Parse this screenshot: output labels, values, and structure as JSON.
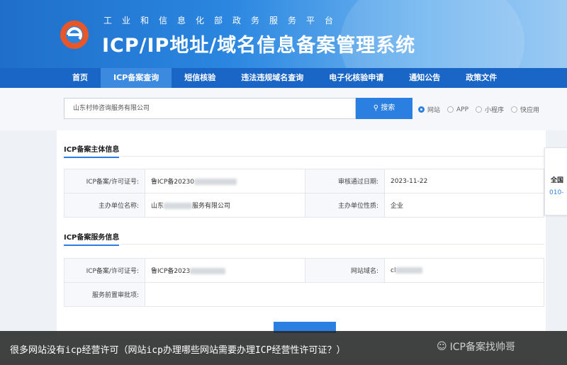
{
  "header": {
    "ministry": "工业和信息化部政务服务平台",
    "title": "ICP/IP地址/域名信息备案管理系统"
  },
  "nav": [
    {
      "label": "首页",
      "active": false
    },
    {
      "label": "ICP备案查询",
      "active": true
    },
    {
      "label": "短信核验",
      "active": false
    },
    {
      "label": "违法违规域名查询",
      "active": false
    },
    {
      "label": "电子化核验申请",
      "active": false
    },
    {
      "label": "通知公告",
      "active": false
    },
    {
      "label": "政策文件",
      "active": false
    }
  ],
  "search": {
    "value": "山东村帅咨询服务有限公司",
    "button_label": "搜索",
    "types": [
      {
        "label": "网站",
        "checked": true
      },
      {
        "label": "APP",
        "checked": false
      },
      {
        "label": "小程序",
        "checked": false
      },
      {
        "label": "快应用",
        "checked": false
      }
    ]
  },
  "subject": {
    "title": "ICP备案主体信息",
    "license_label": "ICP备案/许可证号:",
    "license_value": "鲁ICP备20230",
    "audit_date_label": "审核通过日期:",
    "audit_date_value": "2023-11-22",
    "org_name_label": "主办单位名称:",
    "org_name_prefix": "山东",
    "org_name_suffix": "服务有限公司",
    "org_type_label": "主办单位性质:",
    "org_type_value": "企业"
  },
  "service": {
    "title": "ICP备案服务信息",
    "license_label": "ICP备案/许可证号:",
    "license_value": "鲁ICP备2023",
    "domain_label": "网站域名:",
    "domain_value": "cl",
    "pre_approval_label": "服务前置审批项:",
    "pre_approval_value": ""
  },
  "side_widget": {
    "line1": "全国",
    "line2": "010-"
  },
  "caption": {
    "text": "很多网站没有icp经营许可（网站icp办理哪些网站需要办理ICP经营性许可证？）",
    "watermark": "ICP备案找帅哥"
  }
}
